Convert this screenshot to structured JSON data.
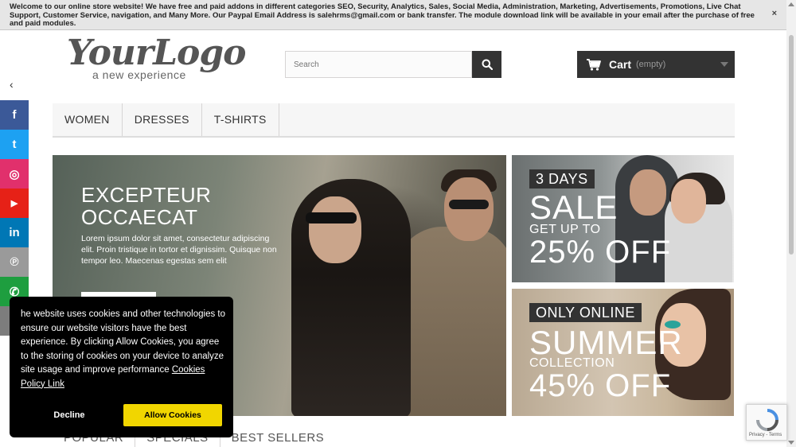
{
  "notice": {
    "text": "Welcome to our online store website! We have free and paid addons in different categories SEO, Security, Analytics, Sales, Social Media, Administration, Marketing, Advertisements, Promotions, Live Chat Support, Customer Service, navigation, and Many More. Our Paypal Email Address is salehrms@gmail.com or bank transfer. The module download link will be available in your email after the purchase of free and paid modules.",
    "close": "×"
  },
  "logo": {
    "main": "YourLogo",
    "tagline": "a new experience"
  },
  "search": {
    "placeholder": "Search"
  },
  "cart": {
    "label": "Cart",
    "status": "(empty)"
  },
  "menu": {
    "items": [
      "WOMEN",
      "DRESSES",
      "T-SHIRTS"
    ]
  },
  "hero": {
    "title": "EXCEPTEUR OCCAECAT",
    "text": "Lorem ipsum dolor sit amet, consectetur adipiscing elit. Proin tristique in tortor et dignissim. Quisque non tempor leo. Maecenas egestas sem elit"
  },
  "promo1": {
    "badge": "3 DAYS",
    "big": "SALE",
    "small": "GET UP TO",
    "pct": "25% OFF"
  },
  "promo2": {
    "badge": "ONLY ONLINE",
    "big": "SUMMER",
    "small": "COLLECTION",
    "pct": "45% OFF"
  },
  "social": {
    "toggle": "‹",
    "items": [
      {
        "name": "facebook",
        "glyph": "f",
        "color": "#3b5998"
      },
      {
        "name": "twitter",
        "glyph": "t",
        "color": "#1da1f2"
      },
      {
        "name": "instagram",
        "glyph": "◎",
        "color": "#e1306c"
      },
      {
        "name": "youtube",
        "glyph": "▶",
        "color": "#e62117"
      },
      {
        "name": "linkedin",
        "glyph": "in",
        "color": "#0077b5"
      },
      {
        "name": "pinterest",
        "glyph": "℗",
        "color": "#9a9a9a"
      },
      {
        "name": "whatsapp",
        "glyph": "✆",
        "color": "#1e9e3f"
      },
      {
        "name": "email",
        "glyph": "✉",
        "color": "#7d7d7d"
      }
    ]
  },
  "tabs": [
    "POPULAR",
    "SPECIALS",
    "BEST SELLERS"
  ],
  "cookie": {
    "text": "he website uses cookies and other technologies to ensure our website visitors have the best experience. By clicking Allow Cookies, you agree to the storing of cookies on your device to analyze site usage and improve performance",
    "link": "Cookies Policy Link",
    "decline": "Decline",
    "allow": "Allow Cookies"
  },
  "recaptcha": {
    "text": "Privacy - Terms"
  }
}
